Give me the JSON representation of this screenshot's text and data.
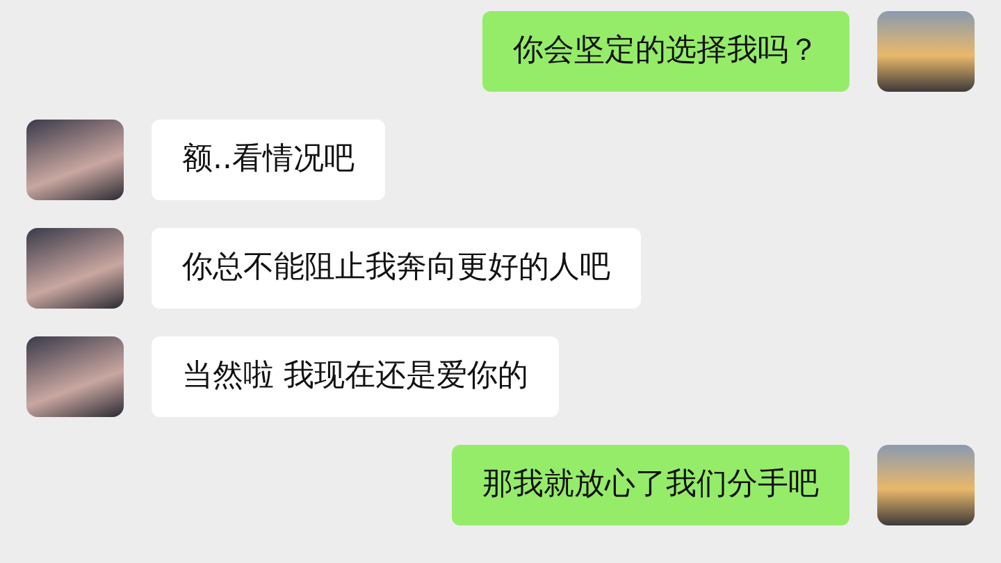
{
  "messages": [
    {
      "outgoing": true,
      "text": "你会坚定的选择我吗？"
    },
    {
      "outgoing": false,
      "text": "额..看情况吧"
    },
    {
      "outgoing": false,
      "text": "你总不能阻止我奔向更好的人吧"
    },
    {
      "outgoing": false,
      "text": "当然啦 我现在还是爱你的"
    },
    {
      "outgoing": true,
      "text": "那我就放心了我们分手吧"
    }
  ]
}
